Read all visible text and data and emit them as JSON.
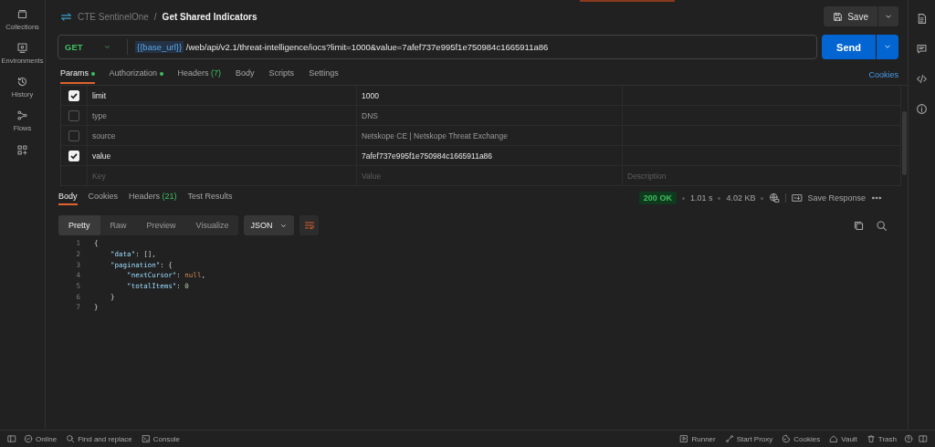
{
  "sidebar": {
    "items": [
      {
        "label": "Collections"
      },
      {
        "label": "Environments"
      },
      {
        "label": "History"
      },
      {
        "label": "Flows"
      }
    ]
  },
  "header": {
    "collection": "CTE SentinelOne",
    "separator": "/",
    "title": "Get Shared Indicators",
    "save": "Save"
  },
  "request": {
    "method": "GET",
    "url_variable": "{{base_url}}",
    "url_path": "/web/api/v2.1/threat-intelligence/iocs?limit=1000&value=7afef737e995f1e750984c1665911a86",
    "send": "Send"
  },
  "request_tabs": [
    {
      "label": "Params",
      "dot": true,
      "selected": true
    },
    {
      "label": "Authorization",
      "dot": true,
      "selected": false
    },
    {
      "label": "Headers",
      "count": "(7)",
      "dot": false,
      "selected": false
    },
    {
      "label": "Body",
      "dot": false,
      "selected": false
    },
    {
      "label": "Scripts",
      "dot": false,
      "selected": false
    },
    {
      "label": "Settings",
      "dot": false,
      "selected": false
    }
  ],
  "cookies_link": "Cookies",
  "params": {
    "rows": [
      {
        "kind": "param",
        "checked": true,
        "key": "limit",
        "value": "1000"
      },
      {
        "kind": "param",
        "checked": false,
        "key": "type",
        "value": "DNS"
      },
      {
        "kind": "param",
        "checked": false,
        "key": "source",
        "value": "Netskope CE | Netskope Threat Exchange"
      },
      {
        "kind": "param",
        "checked": true,
        "key": "value",
        "value": "7afef737e995f1e750984c1665911a86"
      },
      {
        "kind": "placeholder",
        "key": "Key",
        "value": "Value",
        "description": "Description"
      }
    ]
  },
  "response_tabs": [
    {
      "label": "Body",
      "selected": true
    },
    {
      "label": "Cookies",
      "selected": false
    },
    {
      "label": "Headers",
      "count": "(21)",
      "selected": false
    },
    {
      "label": "Test Results",
      "selected": false
    }
  ],
  "response_meta": {
    "status": "200 OK",
    "time": "1.01 s",
    "size": "4.02 KB",
    "save_response": "Save Response"
  },
  "view_modes": [
    {
      "label": "Pretty",
      "selected": true
    },
    {
      "label": "Raw",
      "selected": false
    },
    {
      "label": "Preview",
      "selected": false
    },
    {
      "label": "Visualize",
      "selected": false
    }
  ],
  "format": "JSON",
  "code_lines": [
    {
      "number": "1",
      "tokens": [
        {
          "kind": "punct",
          "text": "{"
        }
      ]
    },
    {
      "number": "2",
      "tokens": [
        {
          "kind": "key",
          "text": "    \"data\""
        },
        {
          "kind": "punct",
          "text": ": [],"
        }
      ]
    },
    {
      "number": "3",
      "tokens": [
        {
          "kind": "key",
          "text": "    \"pagination\""
        },
        {
          "kind": "punct",
          "text": ": {"
        }
      ]
    },
    {
      "number": "4",
      "tokens": [
        {
          "kind": "key",
          "text": "        \"nextCursor\""
        },
        {
          "kind": "punct",
          "text": ": "
        },
        {
          "kind": "null",
          "text": "null"
        },
        {
          "kind": "punct",
          "text": ","
        }
      ]
    },
    {
      "number": "5",
      "tokens": [
        {
          "kind": "key",
          "text": "        \"totalItems\""
        },
        {
          "kind": "punct",
          "text": ": "
        },
        {
          "kind": "number",
          "text": "0"
        }
      ]
    },
    {
      "number": "6",
      "tokens": [
        {
          "kind": "punct",
          "text": "    }"
        }
      ]
    },
    {
      "number": "7",
      "tokens": [
        {
          "kind": "punct",
          "text": "}"
        }
      ]
    }
  ],
  "status_bar": {
    "left": [
      {
        "kind": "online",
        "label": "Online"
      },
      {
        "kind": "find",
        "label": "Find and replace"
      },
      {
        "kind": "console",
        "label": "Console"
      }
    ],
    "right": [
      {
        "kind": "runner",
        "label": "Runner"
      },
      {
        "kind": "proxy",
        "label": "Start Proxy"
      },
      {
        "kind": "cookies",
        "label": "Cookies"
      },
      {
        "kind": "vault",
        "label": "Vault"
      },
      {
        "kind": "trash",
        "label": "Trash"
      }
    ]
  }
}
